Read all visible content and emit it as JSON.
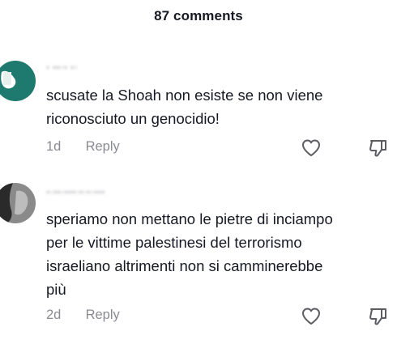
{
  "header": {
    "comments_count_label": "87 comments"
  },
  "comments": [
    {
      "username": "",
      "text": "scusate la Shoah non esiste se non viene\nriconosciuto un genocidio!",
      "time": "1d",
      "reply_label": "Reply",
      "avatar_colors": [
        "#1e7a6e",
        "#ffffff"
      ]
    },
    {
      "username": "",
      "text": "speriamo non mettano le pietre di inciampo\nper le vittime palestinesi del terrorismo\nisraeliano altrimenti non si camminerebbe\npiù",
      "time": "2d",
      "reply_label": "Reply",
      "avatar_colors": [
        "#6f6f6f",
        "#2a2a2a"
      ]
    }
  ],
  "icons": {
    "like": "heart-icon",
    "dislike": "thumbs-down-icon"
  },
  "colors": {
    "text": "#161823",
    "secondary": "#8a8b91",
    "icon": "#5c5d63"
  }
}
